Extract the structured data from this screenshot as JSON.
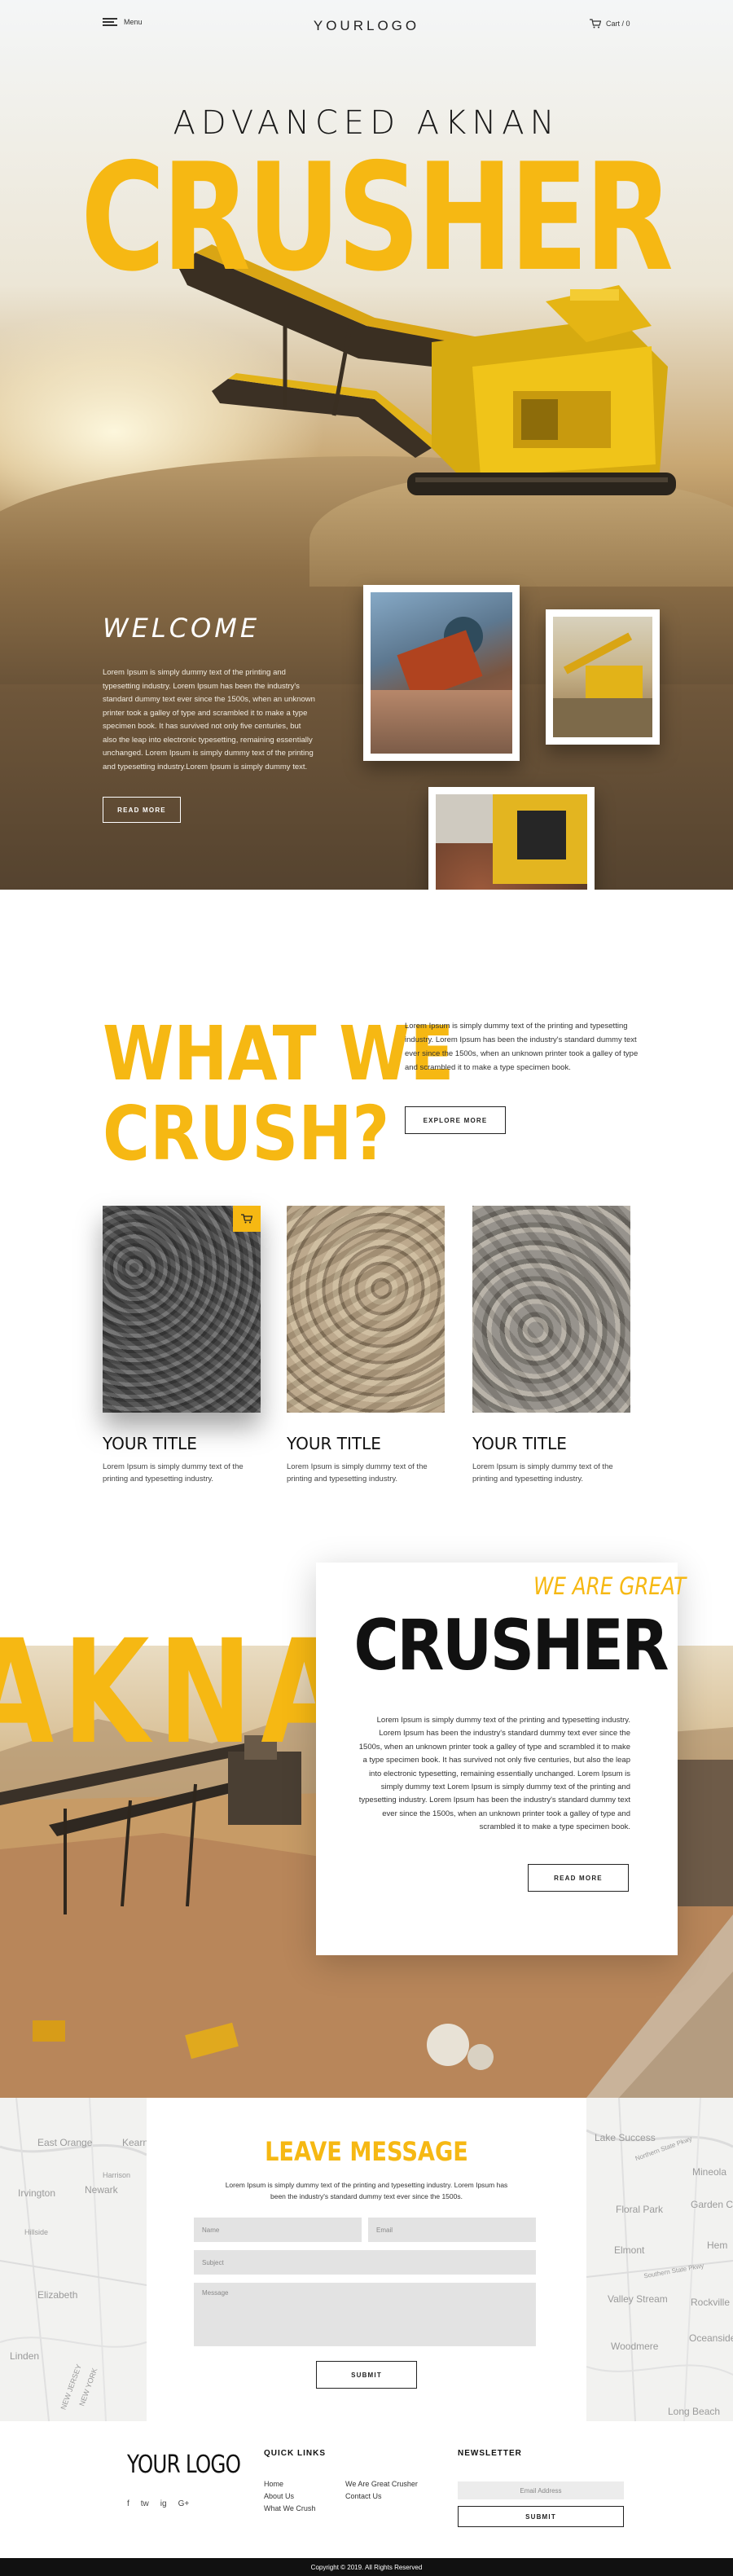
{
  "nav": {
    "menu_label": "Menu",
    "logo": "YOURLOGO",
    "cart_label": "Cart / 0"
  },
  "hero": {
    "subtitle": "ADVANCED AKNAN",
    "title": "CRUSHER",
    "welcome_title": "WELCOME",
    "welcome_text": "Lorem Ipsum is simply dummy text of the printing and typesetting industry. Lorem Ipsum has been the industry's standard dummy text ever since the 1500s, when an unknown printer took a galley of type and scrambled it to make a type specimen book. It has survived not only five centuries, but also the leap into electronic typesetting, remaining essentially unchanged. Lorem Ipsum is simply dummy text of the printing and typesetting industry.Lorem Ipsum is simply dummy text.",
    "read_more": "READ MORE"
  },
  "crush": {
    "title_line1": "WHAT WE",
    "title_line2": "CRUSH?",
    "text": "Lorem Ipsum is simply dummy text of the printing and typesetting industry. Lorem Ipsum has been the industry's standard dummy text ever since the 1500s, when an unknown printer took a galley of type and scrambled it to make a type specimen book.",
    "explore": "EXPLORE MORE",
    "cards": [
      {
        "title": "YOUR TITLE",
        "text": "Lorem Ipsum is simply dummy text of the printing and typesetting industry."
      },
      {
        "title": "YOUR TITLE",
        "text": "Lorem Ipsum is simply dummy text of the printing and typesetting industry."
      },
      {
        "title": "YOUR TITLE",
        "text": "Lorem Ipsum is simply dummy text of the printing and typesetting industry."
      }
    ]
  },
  "great": {
    "background_word": "AKNAN",
    "kicker": "WE ARE GREAT",
    "title": "CRUSHER",
    "text": "Lorem Ipsum is simply dummy text of the printing and typesetting industry. Lorem Ipsum has been the industry's standard dummy text ever since the 1500s, when an unknown printer took a galley of type and scrambled it to make a type specimen book. It has survived not only five centuries, but also the leap into electronic typesetting, remaining essentially unchanged. Lorem Ipsum is simply dummy text Lorem Ipsum is simply dummy text of the printing and typesetting industry. Lorem Ipsum has been the industry's standard dummy text ever since the 1500s, when an unknown printer took a galley of type and scrambled it to make a type specimen book.",
    "read_more": "READ MORE"
  },
  "contact": {
    "title": "LEAVE MESSAGE",
    "text": "Lorem Ipsum is simply dummy text of the printing and typesetting industry. Lorem Ipsum has been the industry's standard dummy text ever since the 1500s.",
    "name_placeholder": "Name",
    "email_placeholder": "Email",
    "subject_placeholder": "Subject",
    "message_placeholder": "Message",
    "submit": "SUBMIT"
  },
  "map_labels": {
    "left": [
      "East Orange",
      "Kearn",
      "Harrison",
      "Irvington",
      "Newark",
      "Hillside",
      "Elizabeth",
      "Linden",
      "NEW JERSEY",
      "NEW YORK"
    ],
    "right": [
      "Lake Success",
      "Northern State Pkwy",
      "Mineola",
      "Floral Park",
      "Garden C",
      "Elmont",
      "Hem",
      "Southern State Pkwy",
      "Valley Stream",
      "Rockville Centre",
      "Woodmere",
      "Oceanside",
      "Long Beach"
    ]
  },
  "footer": {
    "logo": "YOUR LOGO",
    "social": [
      "f",
      "tw",
      "ig",
      "G+"
    ],
    "quick_links_head": "QUICK LINKS",
    "links_col1": [
      "Home",
      "About Us",
      "What We Crush"
    ],
    "links_col2": [
      "We Are Great Crusher",
      "Contact Us"
    ],
    "newsletter_head": "NEWSLETTER",
    "newsletter_placeholder": "Email Address",
    "newsletter_submit": "SUBMIT",
    "copyright": "Copyright © 2019. All Rights Reserved"
  },
  "colors": {
    "accent": "#f6b813",
    "dark": "#111111"
  }
}
